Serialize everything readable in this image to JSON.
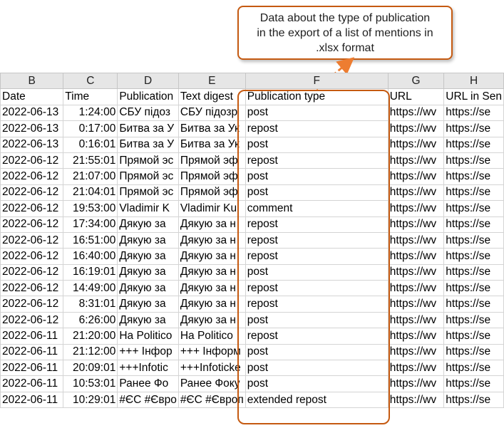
{
  "callout": {
    "lines": [
      "Data about the type of publication",
      "in the export of a list of mentions in",
      ".xlsx format"
    ]
  },
  "columns": [
    "B",
    "C",
    "D",
    "E",
    "F",
    "G",
    "H"
  ],
  "headers": [
    "Date",
    "Time",
    "Publication",
    "Text digest",
    "Publication type",
    "URL",
    "URL in Sen"
  ],
  "rows": [
    [
      "2022-06-13",
      "1:24:00",
      "СБУ підоз",
      "СБУ підозр",
      "post",
      "https://wv",
      "https://se"
    ],
    [
      "2022-06-13",
      "0:17:00",
      "Битва за У",
      "Битва за Ук",
      "repost",
      "https://wv",
      "https://se"
    ],
    [
      "2022-06-13",
      "0:16:01",
      "Битва за У",
      "Битва за Ук",
      "post",
      "https://wv",
      "https://se"
    ],
    [
      "2022-06-12",
      "21:55:01",
      "Прямой эс",
      "Прямой эф",
      "repost",
      "https://wv",
      "https://se"
    ],
    [
      "2022-06-12",
      "21:07:00",
      "Прямой эс",
      "Прямой эф",
      "post",
      "https://wv",
      "https://se"
    ],
    [
      "2022-06-12",
      "21:04:01",
      "Прямой эс",
      "Прямой эф",
      "post",
      "https://wv",
      "https://se"
    ],
    [
      "2022-06-12",
      "19:53:00",
      "Vladimir K",
      "Vladimir Ku",
      "comment",
      "https://wv",
      "https://se"
    ],
    [
      "2022-06-12",
      "17:34:00",
      "Дякую за",
      "Дякую за н",
      "repost",
      "https://wv",
      "https://se"
    ],
    [
      "2022-06-12",
      "16:51:00",
      "Дякую за",
      "Дякую за н",
      "repost",
      "https://wv",
      "https://se"
    ],
    [
      "2022-06-12",
      "16:40:00",
      "Дякую за",
      "Дякую за н",
      "repost",
      "https://wv",
      "https://se"
    ],
    [
      "2022-06-12",
      "16:19:01",
      "Дякую за",
      "Дякую за н",
      "post",
      "https://wv",
      "https://se"
    ],
    [
      "2022-06-12",
      "14:49:00",
      "Дякую за",
      "Дякую за н",
      "repost",
      "https://wv",
      "https://se"
    ],
    [
      "2022-06-12",
      "8:31:01",
      "Дякую за",
      "Дякую за н",
      "repost",
      "https://wv",
      "https://se"
    ],
    [
      "2022-06-12",
      "6:26:00",
      "Дякую за",
      "Дякую за н",
      "post",
      "https://wv",
      "https://se"
    ],
    [
      "2022-06-11",
      "21:20:00",
      "На Politico",
      "На Politico",
      "repost",
      "https://wv",
      "https://se"
    ],
    [
      "2022-06-11",
      "21:12:00",
      "+++ Інфор",
      "+++ Інформ",
      "post",
      "https://wv",
      "https://se"
    ],
    [
      "2022-06-11",
      "20:09:01",
      "+++Infotic",
      "+++Infoticke",
      "post",
      "https://wv",
      "https://se"
    ],
    [
      "2022-06-11",
      "10:53:01",
      "Ранее Фо",
      "Ранее Фоку",
      "post",
      "https://wv",
      "https://se"
    ],
    [
      "2022-06-11",
      "10:29:01",
      "#ЄС #Євро",
      "#ЄС #Європ",
      "extended repost",
      "https://wv",
      "https://se"
    ]
  ],
  "colors": {
    "accent": "#c55a11",
    "header_bg": "#e6e6e6",
    "grid": "#d4d4d4"
  }
}
